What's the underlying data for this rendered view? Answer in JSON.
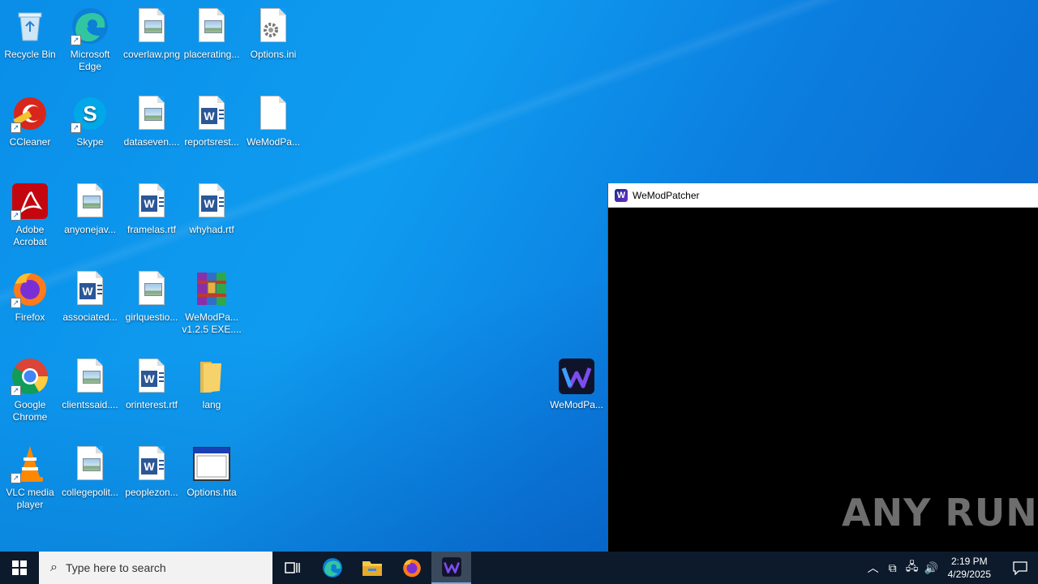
{
  "desktop": {
    "icons": [
      {
        "label": "Recycle Bin"
      },
      {
        "label": "Microsoft Edge"
      },
      {
        "label": "coverlaw.png"
      },
      {
        "label": "placerating..."
      },
      {
        "label": "Options.ini"
      },
      {
        "label": "CCleaner"
      },
      {
        "label": "Skype"
      },
      {
        "label": "dataseven...."
      },
      {
        "label": "reportsrest..."
      },
      {
        "label": "WeModPa..."
      },
      {
        "label": "Adobe Acrobat"
      },
      {
        "label": "anyonejav..."
      },
      {
        "label": "framelas.rtf"
      },
      {
        "label": "whyhad.rtf"
      },
      {
        "label": "Firefox"
      },
      {
        "label": "associated..."
      },
      {
        "label": "girlquestio..."
      },
      {
        "label": "WeModPa... v1.2.5 EXE...."
      },
      {
        "label": "Google Chrome"
      },
      {
        "label": "clientssaid...."
      },
      {
        "label": "orinterest.rtf"
      },
      {
        "label": "lang"
      },
      {
        "label": "VLC media player"
      },
      {
        "label": "collegepolit..."
      },
      {
        "label": "peoplezon..."
      },
      {
        "label": "Options.hta"
      },
      {
        "label": "WeModPa..."
      }
    ]
  },
  "window": {
    "title": "WeModPatcher"
  },
  "watermark": "ANY RUN",
  "taskbar": {
    "search_placeholder": "Type here to search",
    "time": "2:19 PM",
    "date": "4/29/2025"
  }
}
